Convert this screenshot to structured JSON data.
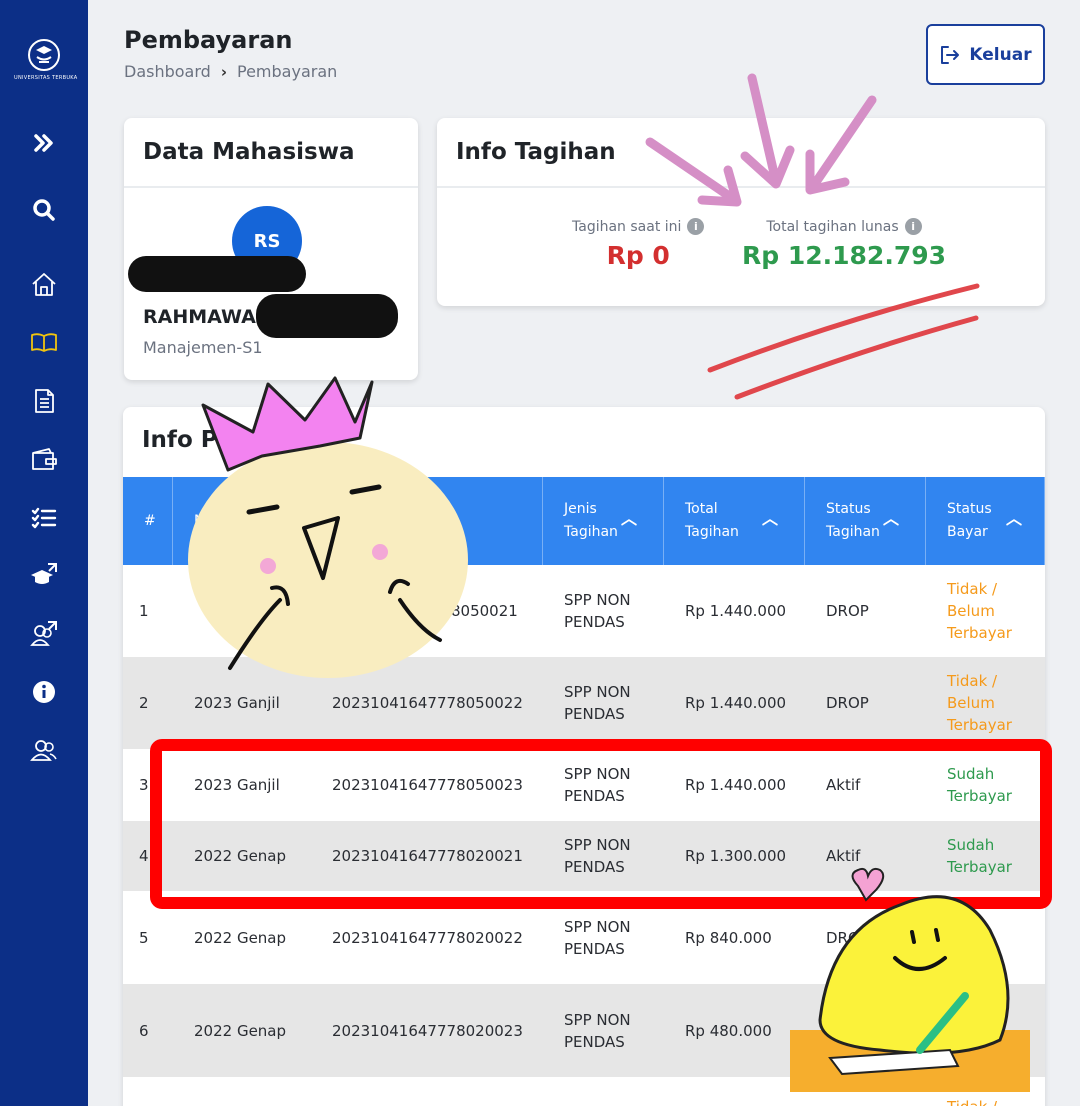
{
  "sidebar": {
    "logo_text": "UNIVERSITAS TERBUKA",
    "items": [
      {
        "icon": "double-chevron-right-icon"
      },
      {
        "icon": "search-icon"
      },
      {
        "icon": "home-icon"
      },
      {
        "icon": "book-icon",
        "active": true
      },
      {
        "icon": "document-icon"
      },
      {
        "icon": "wallet-icon"
      },
      {
        "icon": "checklist-icon"
      },
      {
        "icon": "graduation-cap-external-icon"
      },
      {
        "icon": "users-external-icon"
      },
      {
        "icon": "info-icon"
      },
      {
        "icon": "users-icon"
      }
    ],
    "bg_color": "#0c2f87",
    "active_color": "#f1c40f"
  },
  "header": {
    "title": "Pembayaran",
    "breadcrumb": [
      "Dashboard",
      "Pembayaran"
    ],
    "logout_label": "Keluar"
  },
  "student_card": {
    "title": "Data Mahasiswa",
    "initials": "RS",
    "name": "RAHMAWA",
    "program": "Manajemen-S1"
  },
  "bill_card": {
    "title": "Info Tagihan",
    "current_label": "Tagihan saat ini",
    "current_value": "Rp 0",
    "paid_label": "Total tagihan lunas",
    "paid_value": "Rp 12.182.793",
    "current_color": "#d32f2f",
    "paid_color": "#2e9a4e"
  },
  "payment_info": {
    "title": "Info P",
    "columns": [
      {
        "label": "#",
        "sortable": false
      },
      {
        "label": "M",
        "sortable": false
      },
      {
        "label": "",
        "sortable": false
      },
      {
        "label": "Jenis Tagihan",
        "sortable": true
      },
      {
        "label": "Total Tagihan",
        "sortable": true
      },
      {
        "label": "Status Tagihan",
        "sortable": true
      },
      {
        "label": "Status Bayar",
        "sortable": true
      }
    ],
    "rows": [
      {
        "no": "1",
        "periode": "",
        "kode": "8050021",
        "jenis": "SPP NON PENDAS",
        "total": "Rp 1.440.000",
        "status_tagihan": "DROP",
        "status_bayar": "Tidak / Belum Terbayar",
        "paid": false
      },
      {
        "no": "2",
        "periode": "2023 Ganjil",
        "kode": "20231041647778050022",
        "jenis": "SPP NON PENDAS",
        "total": "Rp 1.440.000",
        "status_tagihan": "DROP",
        "status_bayar": "Tidak / Belum Terbayar",
        "paid": false
      },
      {
        "no": "3",
        "periode": "2023 Ganjil",
        "kode": "20231041647778050023",
        "jenis": "SPP NON PENDAS",
        "total": "Rp 1.440.000",
        "status_tagihan": "Aktif",
        "status_bayar": "Sudah Terbayar",
        "paid": true
      },
      {
        "no": "4",
        "periode": "2022 Genap",
        "kode": "20231041647778020021",
        "jenis": "SPP NON PENDAS",
        "total": "Rp 1.300.000",
        "status_tagihan": "Aktif",
        "status_bayar": "Sudah Terbayar",
        "paid": true
      },
      {
        "no": "5",
        "periode": "2022 Genap",
        "kode": "20231041647778020022",
        "jenis": "SPP NON PENDAS",
        "total": "Rp 840.000",
        "status_tagihan": "DRO",
        "status_bayar": "",
        "paid": false
      },
      {
        "no": "6",
        "periode": "2022 Genap",
        "kode": "20231041647778020023",
        "jenis": "SPP NON PENDAS",
        "total": "Rp 480.000",
        "status_tagihan": "",
        "status_bayar": "",
        "paid": false
      },
      {
        "no": "",
        "periode": "",
        "kode": "",
        "jenis": "",
        "total": "",
        "status_tagihan": "",
        "status_bayar": "Tidak /",
        "paid": false
      }
    ]
  }
}
